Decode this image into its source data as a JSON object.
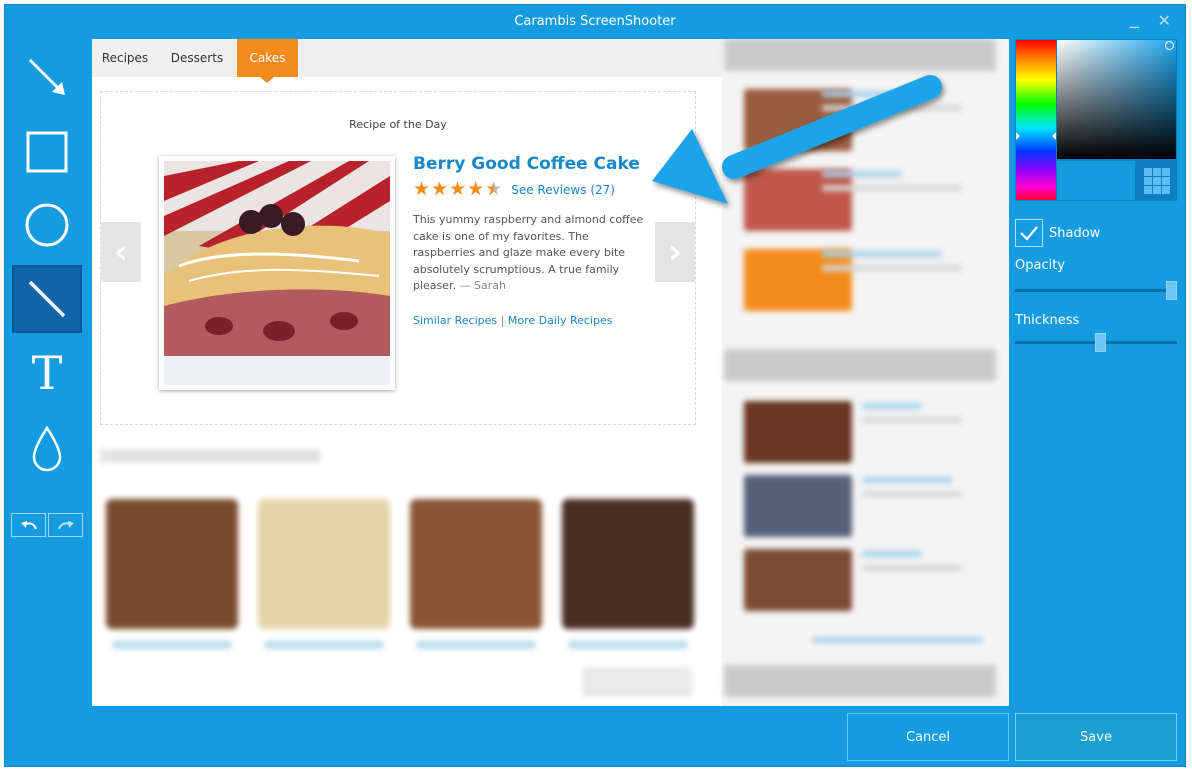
{
  "window": {
    "title": "Carambis ScreenShooter",
    "minimize_label": "_",
    "close_label": "✕"
  },
  "tools": [
    {
      "name": "arrow-tool",
      "icon": "arrow-icon"
    },
    {
      "name": "rectangle-tool",
      "icon": "rectangle-icon"
    },
    {
      "name": "ellipse-tool",
      "icon": "ellipse-icon"
    },
    {
      "name": "line-tool",
      "icon": "line-icon",
      "selected": true
    },
    {
      "name": "text-tool",
      "icon": "text-icon",
      "glyph": "T"
    },
    {
      "name": "blur-tool",
      "icon": "drop-icon"
    }
  ],
  "page": {
    "tabs": [
      {
        "label": "Recipes"
      },
      {
        "label": "Desserts"
      },
      {
        "label": "Cakes",
        "active": true
      }
    ],
    "rotd_label": "Recipe of the Day",
    "recipe": {
      "title": "Berry Good Coffee Cake",
      "rating": 4.5,
      "rating_max": 5,
      "reviews": "See Reviews (27)",
      "description": "This yummy raspberry and almond coffee cake is one of my favorites. The raspberries and glaze make every bite absolutely scrumptious. A true family pleaser.",
      "author": "— Sarah",
      "link_similar": "Similar Recipes",
      "link_separator": "|",
      "link_more": "More Daily Recipes"
    },
    "prev_arrow": "‹",
    "next_arrow": "›"
  },
  "panel": {
    "shadow_label": "Shadow",
    "shadow_checked": true,
    "opacity_label": "Opacity",
    "opacity_value": 1.0,
    "thickness_label": "Thickness",
    "thickness_value": 0.5,
    "swatch_color": "#159be0"
  },
  "buttons": {
    "cancel": "Cancel",
    "save": "Save"
  },
  "colors": {
    "accent": "#159be0",
    "tab_active": "#f38b1d",
    "link": "#1a87c9"
  }
}
